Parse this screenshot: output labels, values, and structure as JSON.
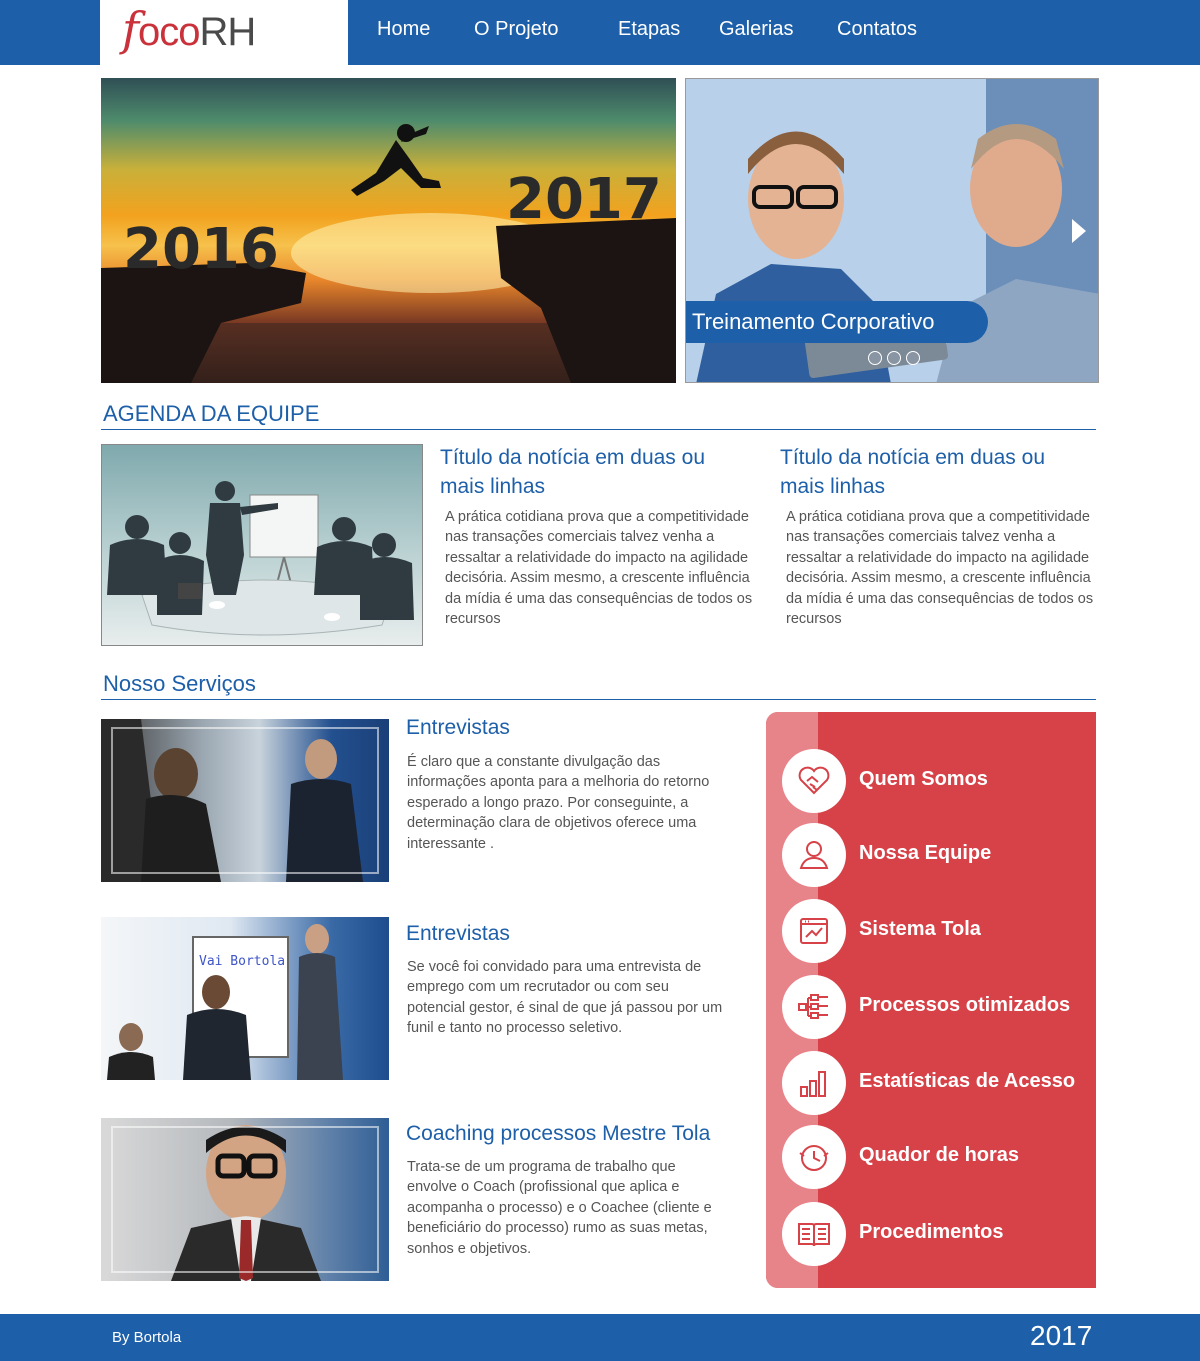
{
  "header": {
    "logo": {
      "part1": "f",
      "part2": "oco",
      "part3": "RH"
    },
    "nav": [
      "Home",
      "O Projeto",
      "Etapas",
      "Galerias",
      "Contatos"
    ]
  },
  "hero": {
    "left_years": [
      "2016",
      "2017"
    ],
    "slider_caption": "Treinamento Corporativo",
    "dots": 3
  },
  "agenda": {
    "title": "AGENDA DA EQUIPE",
    "news": [
      {
        "title": "Título da notícia em duas ou mais linhas",
        "body": "A prática cotidiana prova que a competitividade nas transações comerciais talvez venha a ressaltar a relatividade do impacto na agilidade decisória. Assim mesmo, a crescente influência da mídia é uma das consequências de todos os recursos"
      },
      {
        "title": "Título da notícia em duas ou mais linhas",
        "body": "A prática cotidiana prova que a competitividade nas transações comerciais talvez venha a ressaltar a relatividade do impacto na agilidade decisória. Assim mesmo, a crescente influência da mídia é uma das consequências de todos os recursos"
      }
    ]
  },
  "services": {
    "title": "Nosso Serviços",
    "items": [
      {
        "title": "Entrevistas",
        "body": "É claro que a constante divulgação das informações aponta para a melhoria do retorno esperado a longo prazo. Por conseguinte, a determinação clara de objetivos oferece uma interessante ."
      },
      {
        "title": "Entrevistas",
        "body": "Se você foi convidado para uma entrevista de emprego com um recrutador ou com seu potencial gestor, é sinal de que já passou por um funil e tanto no processo seletivo.",
        "whiteboard_text": "Vai Bortola"
      },
      {
        "title": "Coaching processos Mestre Tola",
        "body": "Trata-se de um programa de trabalho que envolve o Coach (profissional que aplica e acompanha o processo) e o Coachee (cliente e beneficiário do processo) rumo as suas metas, sonhos e objetivos."
      }
    ]
  },
  "panel": {
    "items": [
      {
        "label": "Quem Somos",
        "icon": "handshake-icon"
      },
      {
        "label": "Nossa Equipe",
        "icon": "user-icon"
      },
      {
        "label": "Sistema Tola",
        "icon": "browser-window-icon"
      },
      {
        "label": "Processos otimizados",
        "icon": "flowchart-icon"
      },
      {
        "label": "Estatísticas de Acesso",
        "icon": "bar-chart-icon"
      },
      {
        "label": "Quador de horas",
        "icon": "clock-icon"
      },
      {
        "label": "Procedimentos",
        "icon": "open-book-icon"
      }
    ]
  },
  "footer": {
    "left": "By Bortola",
    "right": "2017"
  },
  "colors": {
    "brand_blue": "#1d5fa8",
    "panel_red": "#d64248",
    "logo_red": "#c9313b"
  }
}
